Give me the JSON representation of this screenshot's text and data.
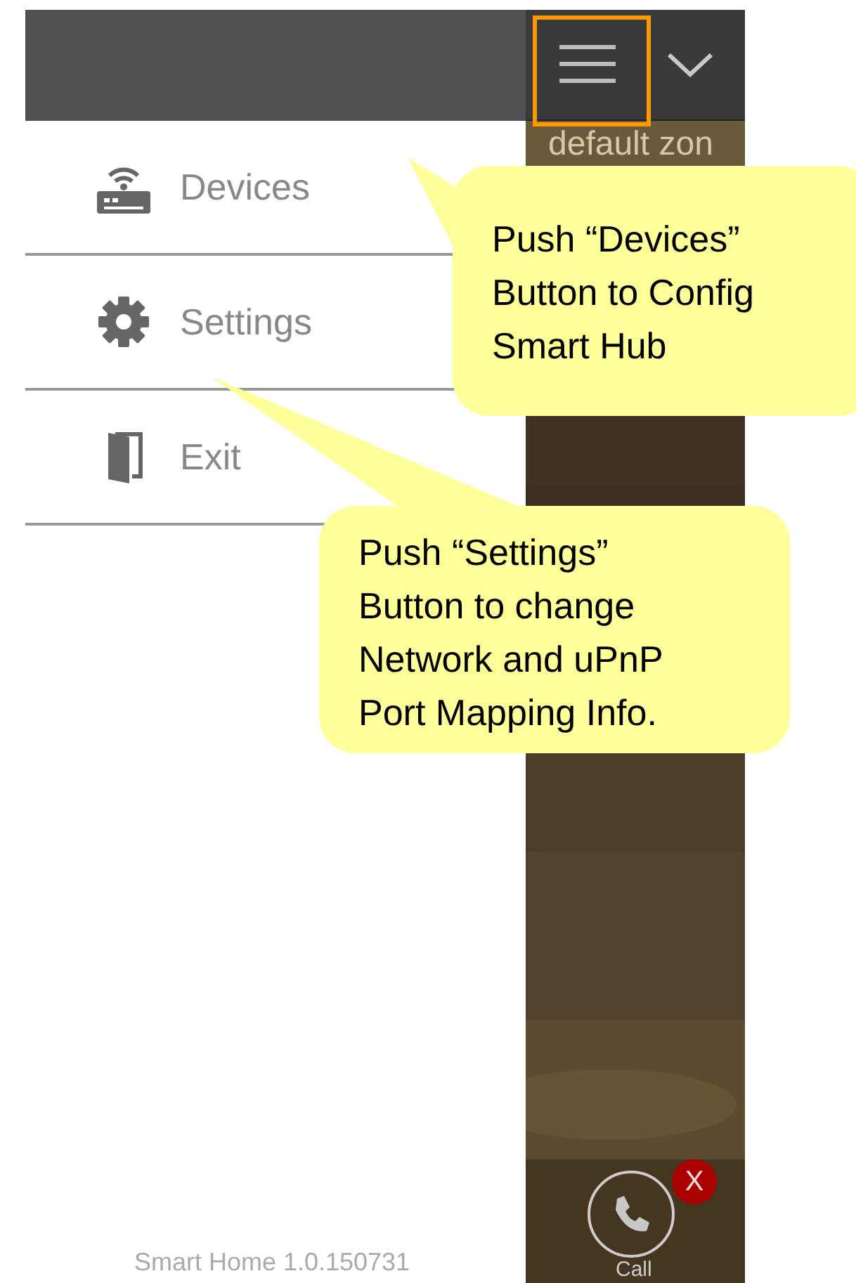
{
  "top_bar": {
    "menu_highlighted": true
  },
  "menu": {
    "items": [
      {
        "kind": "devices",
        "label": "Devices"
      },
      {
        "kind": "settings",
        "label": "Settings"
      },
      {
        "kind": "exit",
        "label": "Exit"
      }
    ]
  },
  "footer": {
    "version": "Smart Home 1.0.150731"
  },
  "camera_panel": {
    "zone_label": "default zon",
    "call_label": "Call",
    "badge": "X"
  },
  "callouts": [
    {
      "lines": [
        "Push “Devices”",
        "Button to Config",
        "Smart Hub"
      ]
    },
    {
      "lines": [
        "Push “Settings”",
        "Button to change",
        "Network and uPnP",
        "Port Mapping Info."
      ]
    }
  ]
}
